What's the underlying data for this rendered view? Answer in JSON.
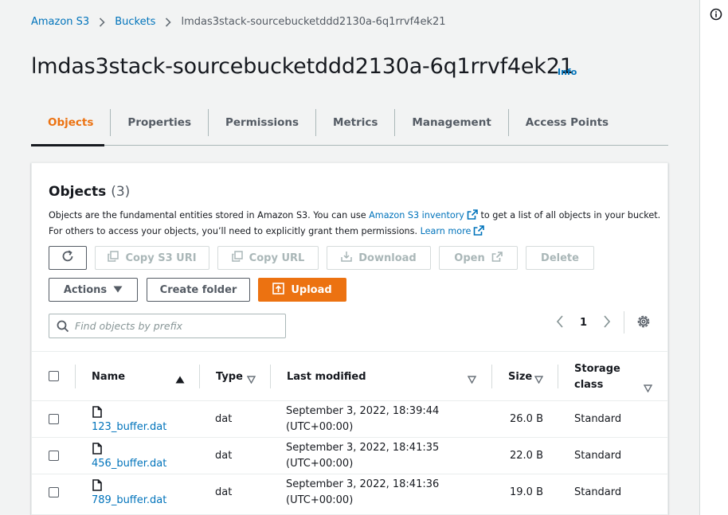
{
  "breadcrumb": {
    "items": [
      "Amazon S3",
      "Buckets"
    ],
    "current": "lmdas3stack-sourcebucketddd2130a-6q1rrvf4ek21"
  },
  "page": {
    "title": "lmdas3stack-sourcebucketddd2130a-6q1rrvf4ek21",
    "info_label": "Info"
  },
  "tabs": [
    {
      "label": "Objects",
      "active": true
    },
    {
      "label": "Properties",
      "active": false
    },
    {
      "label": "Permissions",
      "active": false
    },
    {
      "label": "Metrics",
      "active": false
    },
    {
      "label": "Management",
      "active": false
    },
    {
      "label": "Access Points",
      "active": false
    }
  ],
  "objects_panel": {
    "title": "Objects",
    "count": "(3)",
    "desc_line1_a": "Objects are the fundamental entities stored in Amazon S3. You can use ",
    "desc_line1_link": "Amazon S3 inventory",
    "desc_line1_b": " to get a list of all objects in your bucket.",
    "desc_line2_a": "For others to access your objects, you’ll need to explicitly grant them permissions. ",
    "desc_line2_link": "Learn more"
  },
  "toolbar": {
    "copy_s3_uri": "Copy S3 URI",
    "copy_url": "Copy URL",
    "download": "Download",
    "open": "Open",
    "delete": "Delete",
    "actions": "Actions",
    "create_folder": "Create folder",
    "upload": "Upload"
  },
  "search": {
    "placeholder": "Find objects by prefix"
  },
  "pagination": {
    "current_page": "1"
  },
  "table": {
    "columns": {
      "name": "Name",
      "type": "Type",
      "last_modified": "Last modified",
      "size": "Size",
      "storage_class_1": "Storage",
      "storage_class_2": "class"
    },
    "rows": [
      {
        "name": "123_buffer.dat",
        "type": "dat",
        "modified_1": "September 3, 2022, 18:39:44",
        "modified_2": "(UTC+00:00)",
        "size": "26.0 B",
        "storage": "Standard"
      },
      {
        "name": "456_buffer.dat",
        "type": "dat",
        "modified_1": "September 3, 2022, 18:41:35",
        "modified_2": "(UTC+00:00)",
        "size": "22.0 B",
        "storage": "Standard"
      },
      {
        "name": "789_buffer.dat",
        "type": "dat",
        "modified_1": "September 3, 2022, 18:41:36",
        "modified_2": "(UTC+00:00)",
        "size": "19.0 B",
        "storage": "Standard"
      }
    ]
  },
  "colors": {
    "accent_orange": "#ec7211",
    "link_blue": "#0073bb",
    "text_dark": "#16191f",
    "background": "#f2f3f3"
  }
}
